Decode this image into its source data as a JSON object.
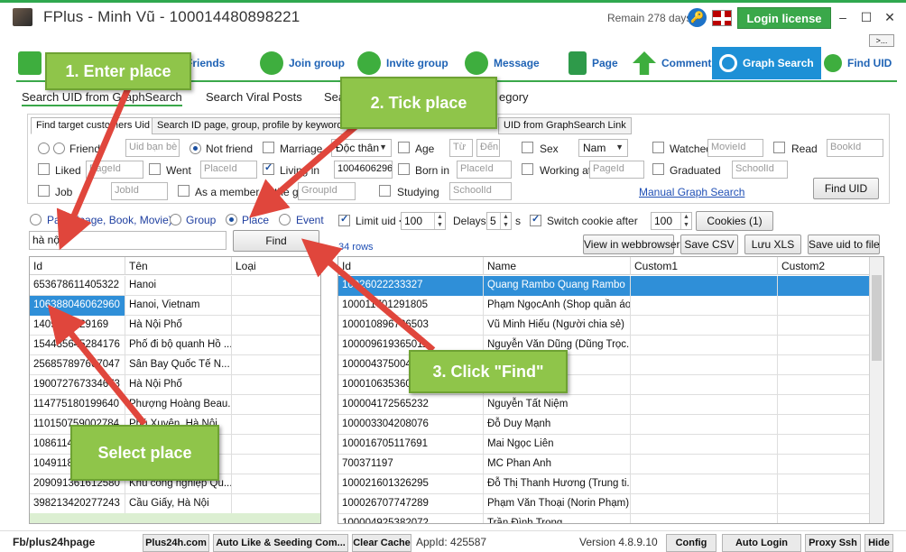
{
  "window": {
    "title": "FPlus - Minh Vũ - 100014480898221",
    "remain": "Remain 278 days",
    "login_label": "Login license",
    "min": "–",
    "max": "☐",
    "close": "✕",
    "more": ">..."
  },
  "toolbar": {
    "friends": "Friends",
    "join_group": "Join group",
    "invite_group": "Invite group",
    "message": "Message",
    "page": "Page",
    "comment": "Comment",
    "graph_search": "Graph Search",
    "find_uid": "Find UID"
  },
  "subtabs": {
    "search_uid": "Search UID from GraphSearch",
    "viral": "Search Viral Posts",
    "sea": "Sea",
    "category": "egory"
  },
  "panel_tabs": {
    "find_target": "Find target customers Uid",
    "search_id": "Search ID page, group, profile by keyword",
    "uid_link": "UID from GraphSearch Link"
  },
  "filters": {
    "friend": "Friend",
    "uid_placeholder": "Uid bạn bè",
    "not_friend": "Not friend",
    "marriage": "Marriage",
    "marriage_value": "Độc thân",
    "age": "Age",
    "age_from": "Từ",
    "age_to": "Đến",
    "sex": "Sex",
    "sex_value": "Nam",
    "watched": "Watched",
    "movie_placeholder": "MovieId",
    "read": "Read",
    "book_placeholder": "BookId",
    "liked": "Liked",
    "page_placeholder": "PageId",
    "went": "Went",
    "place_placeholder": "PlaceId",
    "living_in": "Living in",
    "living_value": "1004606296014",
    "born_in": "Born in",
    "born_placeholder": "PlaceId",
    "working_at": "Working at",
    "working_placeholder": "PageId",
    "graduated": "Graduated",
    "school_placeholder": "SchoolId",
    "job": "Job",
    "job_placeholder": "JobId",
    "member_of": "As a member of the group",
    "group_placeholder": "GroupId",
    "studying": "Studying",
    "studying_placeholder": "SchoolId",
    "manual_link": "Manual Graph Search",
    "find_uid_btn": "Find UID"
  },
  "search": {
    "type_page": "Page (page, Book, Movie)",
    "type_group": "Group",
    "type_place": "Place",
    "type_event": "Event",
    "query": "hà nội",
    "find_btn": "Find"
  },
  "options": {
    "limit_uid": "Limit uid <",
    "limit_value": "100",
    "delays": "Delays",
    "delays_value": "5",
    "delays_unit": "s",
    "switch_cookie": "Switch cookie after",
    "switch_value": "100",
    "cookies_btn": "Cookies (1)"
  },
  "result_actions": {
    "rows": "34 rows",
    "view_web": "View in webbrowser",
    "save_csv": "Save CSV",
    "luu_xls": "Lưu XLS",
    "save_uid": "Save uid to file"
  },
  "places": {
    "headers": [
      "Id",
      "Tên",
      "Loại"
    ],
    "rows": [
      [
        "653678611405322",
        "Hanoi",
        ""
      ],
      [
        "106388046062960",
        "Hanoi, Vietnam",
        ""
      ],
      [
        "1409863229169",
        "Hà Nội Phố",
        ""
      ],
      [
        "154435645284176",
        "Phố đi bộ quanh Hồ ...",
        ""
      ],
      [
        "256857897667047",
        "Sân Bay Quốc Tế N...",
        ""
      ],
      [
        "190072767334673",
        "Hà Nội Phố",
        ""
      ],
      [
        "114775180199640",
        "Phượng Hoàng Beau...",
        ""
      ],
      [
        "110150759002784",
        "Phú Xuyên, Hà Nội",
        ""
      ],
      [
        "108611450",
        "",
        ""
      ],
      [
        "104911850",
        "",
        ""
      ],
      [
        "209091361612580",
        "Khu công nghiệp Qu...",
        ""
      ],
      [
        "398213420277243",
        "Cầu Giấy, Hà Nội",
        ""
      ]
    ]
  },
  "results": {
    "headers": [
      "Id",
      "Name",
      "Custom1",
      "Custom2"
    ],
    "rows": [
      [
        "10026022233327",
        "Quang Rambo Quang Rambo"
      ],
      [
        "100011701291805",
        "Phạm NgọcAnh (Shop quần áo)"
      ],
      [
        "100010896736503",
        "Vũ Minh Hiếu (Người chia sẻ)"
      ],
      [
        "100009619365011",
        "Nguyễn Văn Dũng (Dũng Trọc..."
      ],
      [
        "100004375004124",
        "(�Lu�)"
      ],
      [
        "100010635360120",
        ""
      ],
      [
        "100004172565232",
        "Nguyễn Tất Niệm"
      ],
      [
        "100003304208076",
        "Đỗ Duy Mạnh"
      ],
      [
        "100016705117691",
        "Mai Ngọc Liên"
      ],
      [
        "700371197",
        "MC Phan Anh"
      ],
      [
        "100021601326295",
        "Đỗ Thị Thanh Hương (Trung ti..."
      ],
      [
        "100026707747289",
        "Phạm Văn Thoại (Norin Phạm)"
      ],
      [
        "100004925382072",
        "Trần Đình Trọng"
      ]
    ]
  },
  "callouts": {
    "step1": "1. Enter place",
    "step2": "2. Tick place",
    "step3": "3. Click \"Find\"",
    "step4": "Select place"
  },
  "status": {
    "fb": "Fb/plus24hpage",
    "site": "Plus24h.com",
    "auto_like": "Auto Like & Seeding Com...",
    "clear_cache": "Clear Cache",
    "appid": "AppId: 425587",
    "version": "Version 4.8.9.10",
    "config": "Config",
    "auto_login": "Auto Login",
    "proxy": "Proxy Ssh",
    "hide": "Hide"
  },
  "colors": {
    "accent_green": "#3aa84a",
    "accent_blue": "#1e90d6",
    "callout_green": "#8fc54a"
  }
}
